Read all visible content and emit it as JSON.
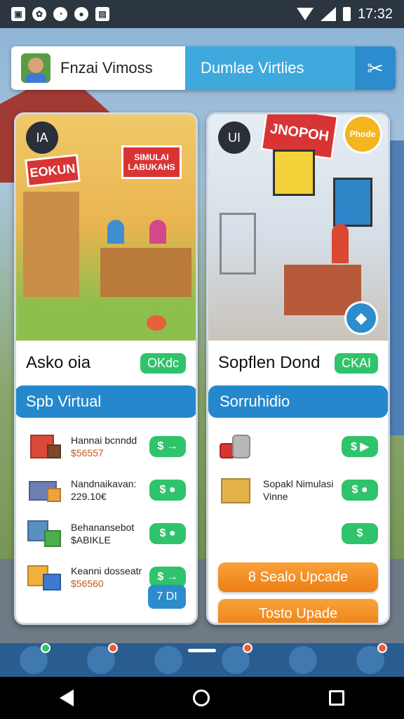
{
  "status": {
    "icons": [
      "gallery-icon",
      "settings-icon",
      "messenger-icon",
      "record-icon",
      "image-icon"
    ],
    "time": "17:32"
  },
  "topbar": {
    "player_name": "Fnzai Vimoss",
    "mode_label": "Dumlae Virtlies",
    "tools_icon": "tools-icon"
  },
  "cards": [
    {
      "badge": "IA",
      "sign_main": "EOKUN",
      "sign_second": "SIMULAI LABUKAHS",
      "title": "Asko oia",
      "chip": "OKdc",
      "bar_label": "Spb Virtual",
      "items": [
        {
          "name": "Hannai bcnndd",
          "price": "$56557",
          "btn": "$ →"
        },
        {
          "name": "Nandnaikavan:",
          "price": "229.10€",
          "btn": "$ ●"
        },
        {
          "name": "Behanansebot",
          "price": "$ABIKLE",
          "btn": "$ ●"
        },
        {
          "name": "Keanni dosseatr",
          "price": "$56560",
          "btn": "$ →"
        }
      ],
      "bottom_btn": "7 DI"
    },
    {
      "badge": "UI",
      "sign_main": "JNOPOH",
      "promo": "Phode",
      "title": "Sopflen Dond",
      "chip": "CKAI",
      "bar_label": "Sorruhidio",
      "items": [
        {
          "name": "",
          "price": "",
          "btn": "$ ▶"
        },
        {
          "name": "Sopakl Nimulasi Vinne",
          "price": "",
          "btn": "$ ●"
        },
        {
          "name": "",
          "price": "",
          "btn": "$"
        }
      ],
      "buttons": [
        "8 Sealo Upcade",
        "Tosto Upade"
      ]
    }
  ],
  "colors": {
    "accent_blue": "#2588cd",
    "accent_green": "#2fc36b",
    "accent_orange": "#ec7f14",
    "sign_red": "#d93434"
  }
}
